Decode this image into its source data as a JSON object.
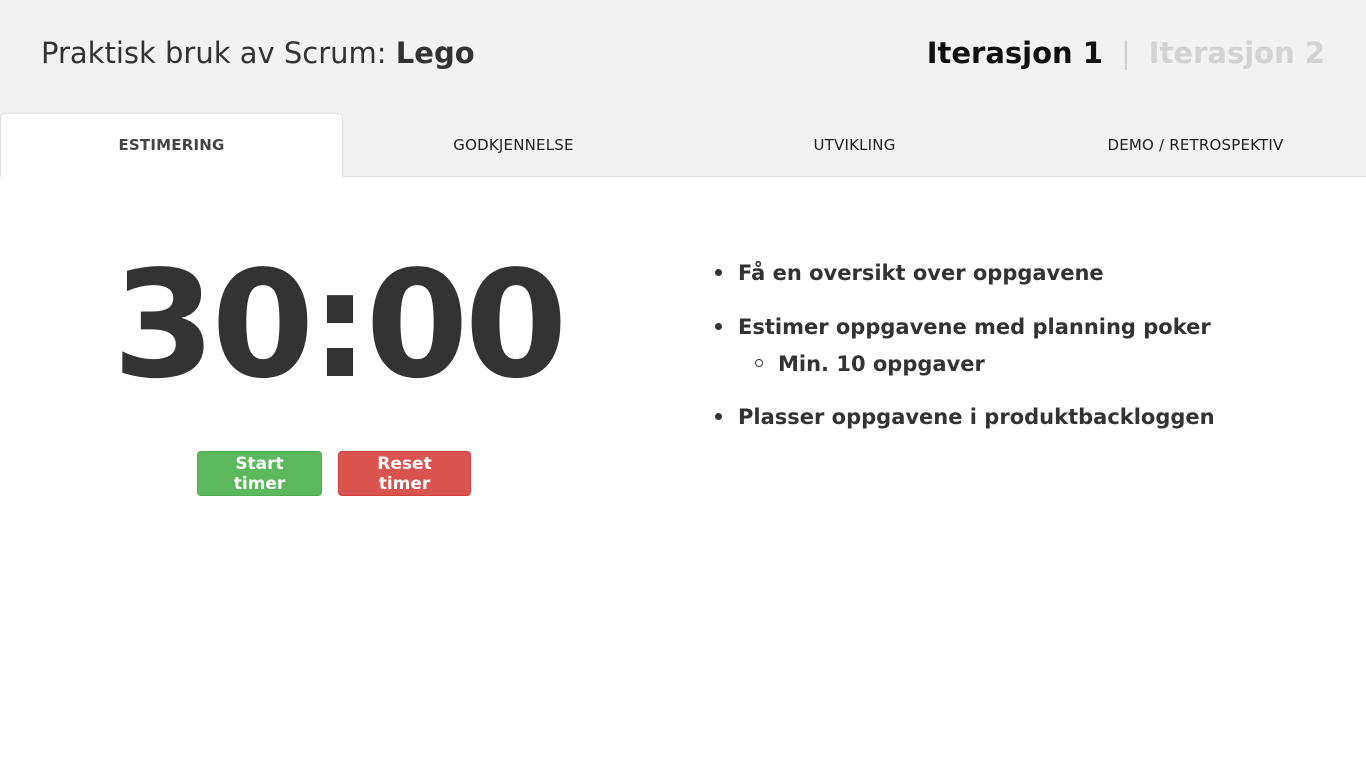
{
  "header": {
    "title_prefix": "Praktisk bruk av Scrum: ",
    "title_bold": "Lego",
    "iterations": [
      {
        "label": "Iterasjon 1",
        "active": true
      },
      {
        "label": "Iterasjon 2",
        "active": false
      }
    ],
    "separator": "|"
  },
  "tabs": [
    {
      "label": "ESTIMERING",
      "active": true
    },
    {
      "label": "GODKJENNELSE",
      "active": false
    },
    {
      "label": "UTVIKLING",
      "active": false
    },
    {
      "label": "DEMO / RETROSPEKTIV",
      "active": false
    }
  ],
  "timer": {
    "display": "30:00",
    "start_label": "Start timer",
    "reset_label": "Reset timer"
  },
  "tasks": {
    "items": [
      {
        "text": "Få en oversikt over oppgavene"
      },
      {
        "text": "Estimer oppgavene med planning poker",
        "sub": [
          "Min. 10 oppgaver"
        ]
      },
      {
        "text": "Plasser oppgavene i produktbackloggen"
      }
    ]
  },
  "colors": {
    "start_button": "#5cb85c",
    "reset_button": "#d9534f",
    "header_bg": "#f2f2f2"
  }
}
